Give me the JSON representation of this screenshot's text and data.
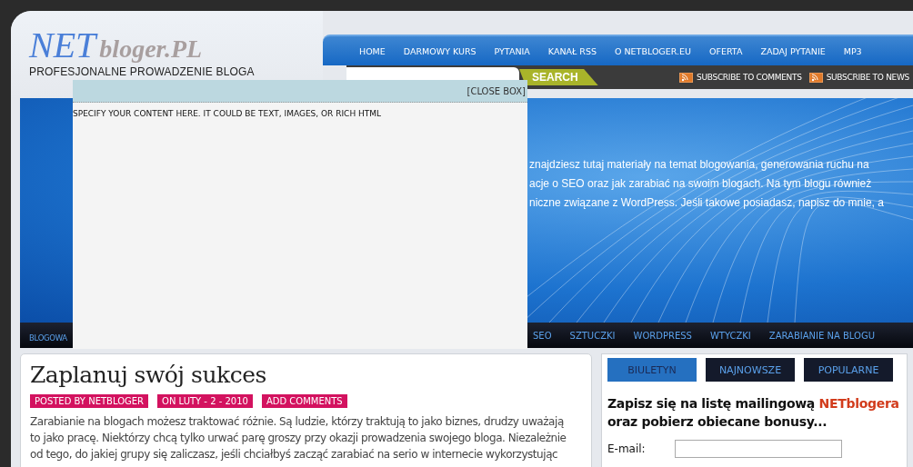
{
  "header": {
    "logo_primary": "NET",
    "logo_secondary": "bloger.PL",
    "tagline": "PROFESJONALNE PROWADZENIE BLOGA",
    "nav": [
      {
        "label": "HOME"
      },
      {
        "label": "DARMOWY KURS"
      },
      {
        "label": "PYTANIA"
      },
      {
        "label": "KANAŁ RSS"
      },
      {
        "label": "O NETBLOGER.EU"
      },
      {
        "label": "OFERTA"
      },
      {
        "label": "ZADAJ PYTANIE"
      },
      {
        "label": "MP3"
      }
    ],
    "search": {
      "button": "SEARCH"
    },
    "subscribe": [
      {
        "label": "SUBSCRIBE TO COMMENTS"
      },
      {
        "label": "SUBSCRIBE TO NEWS"
      }
    ]
  },
  "hero": {
    "text_lines": [
      "znajdziesz tutaj materiały na temat blogowania, generowania ruchu na",
      "acje o SEO oraz jak zarabiać na swoim blogach. Na tym blogu również",
      "niczne związane z WordPress. Jeśli takowe posiadasz, napisz do mnie, a"
    ]
  },
  "category_nav": {
    "items": [
      {
        "label": "BLOGOWA"
      },
      {
        "label": "SEO"
      },
      {
        "label": "SZTUCZKI"
      },
      {
        "label": "WORDPRESS"
      },
      {
        "label": "WTYCZKI"
      },
      {
        "label": "ZARABIANIE NA BLOGU"
      }
    ]
  },
  "post": {
    "title": "Zaplanuj swój sukces",
    "meta": [
      "POSTED BY NETBLOGER",
      "ON LUTY - 2 - 2010",
      "ADD COMMENTS"
    ],
    "body_lines": [
      "Zarabianie na blogach możesz traktować różnie. Są ludzie, którzy traktują to jako biznes, drudzy uważają",
      "to jako pracę. Niektórzy chcą tylko urwać parę groszy przy okazji prowadzenia swojego bloga. Niezależnie",
      "od tego, do jakiej grupy się zaliczasz, jeśli chciałbyś zacząć zarabiać na serio w internecie wykorzystując"
    ]
  },
  "sidebar": {
    "tabs": [
      {
        "label": "BIULETYN",
        "selected": true
      },
      {
        "label": "NAJNOWSZE",
        "selected": false
      },
      {
        "label": "POPULARNE",
        "selected": false
      }
    ],
    "heading": {
      "text": "Zapisz się na listę mailingową ",
      "highlight": "NETblogera",
      "text_after": " oraz pobierz obiecane bonusy..."
    },
    "form": {
      "email_label": "E-mail:"
    }
  },
  "overlay": {
    "close_label": "[CLOSE BOX]",
    "content": "SPECIFY YOUR CONTENT HERE. IT COULD BE TEXT, IMAGES, OR RICH HTML"
  }
}
